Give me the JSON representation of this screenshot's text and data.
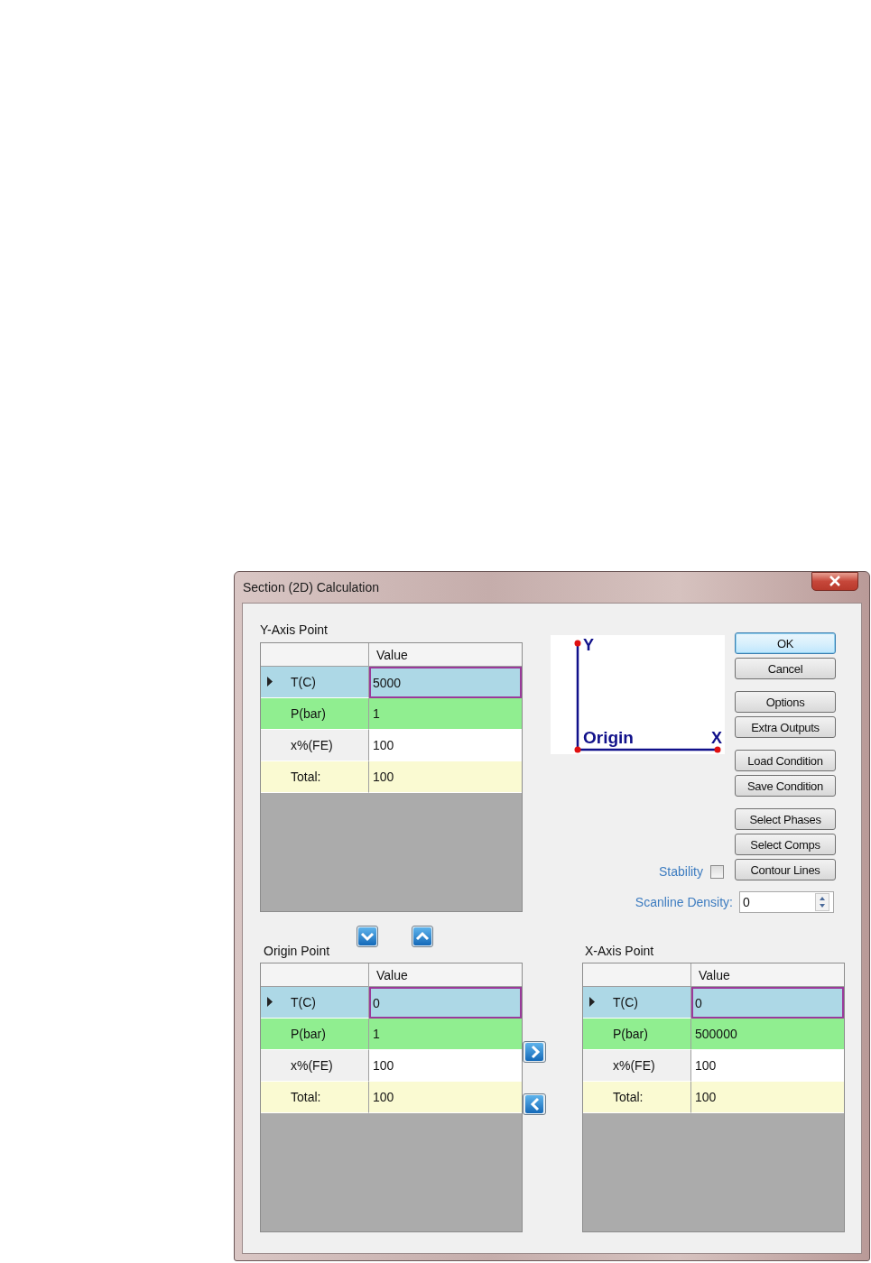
{
  "window": {
    "title": "Section (2D) Calculation"
  },
  "y_axis_point": {
    "title": "Y-Axis Point",
    "column_header": "Value",
    "rows": [
      {
        "label": "T(C)",
        "value": "5000",
        "kind": "temperature",
        "selected": true
      },
      {
        "label": "P(bar)",
        "value": "1",
        "kind": "pressure",
        "selected": false
      },
      {
        "label": "x%(FE)",
        "value": "100",
        "kind": "composition",
        "selected": false
      },
      {
        "label": "Total:",
        "value": "100",
        "kind": "total",
        "selected": false
      }
    ]
  },
  "diagram": {
    "y_label": "Y",
    "origin_label": "Origin",
    "x_label": "X"
  },
  "button_groups": [
    [
      {
        "label": "OK",
        "default": true
      },
      {
        "label": "Cancel",
        "default": false
      }
    ],
    [
      {
        "label": "Options",
        "default": false
      },
      {
        "label": "Extra Outputs",
        "default": false
      }
    ],
    [
      {
        "label": "Load Condition",
        "default": false
      },
      {
        "label": "Save Condition",
        "default": false
      }
    ],
    [
      {
        "label": "Select Phases",
        "default": false
      },
      {
        "label": "Select Comps",
        "default": false
      },
      {
        "label": "Contour Lines",
        "default": false
      }
    ]
  ],
  "stability": {
    "label": "Stability",
    "checked": false
  },
  "scanline_density": {
    "label": "Scanline Density:",
    "value": "0"
  },
  "origin_point": {
    "title": "Origin Point",
    "column_header": "Value",
    "rows": [
      {
        "label": "T(C)",
        "value": "0",
        "kind": "temperature",
        "selected": true
      },
      {
        "label": "P(bar)",
        "value": "1",
        "kind": "pressure",
        "selected": false
      },
      {
        "label": "x%(FE)",
        "value": "100",
        "kind": "composition",
        "selected": false
      },
      {
        "label": "Total:",
        "value": "100",
        "kind": "total",
        "selected": false
      }
    ]
  },
  "x_axis_point": {
    "title": "X-Axis Point",
    "column_header": "Value",
    "rows": [
      {
        "label": "T(C)",
        "value": "0",
        "kind": "temperature",
        "selected": true
      },
      {
        "label": "P(bar)",
        "value": "500000",
        "kind": "pressure",
        "selected": false
      },
      {
        "label": "x%(FE)",
        "value": "100",
        "kind": "composition",
        "selected": false
      },
      {
        "label": "Total:",
        "value": "100",
        "kind": "total",
        "selected": false
      }
    ]
  }
}
